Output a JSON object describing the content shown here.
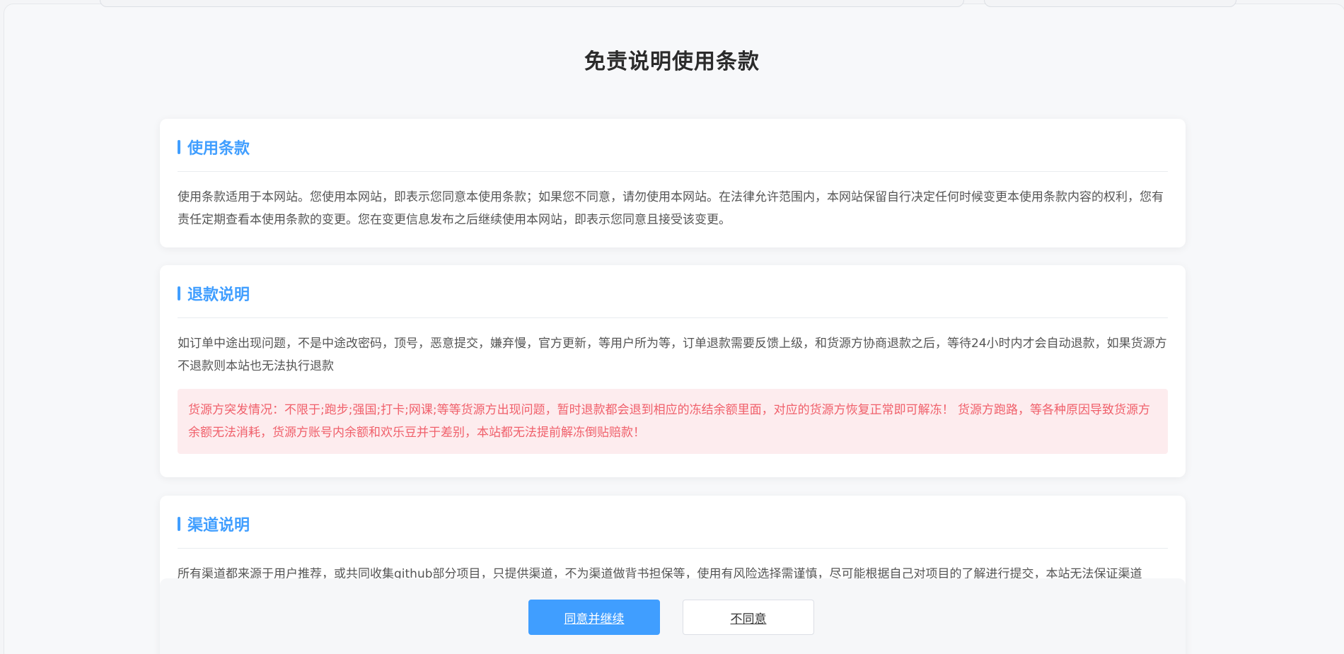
{
  "page": {
    "title": "免责说明使用条款"
  },
  "sections": {
    "terms": {
      "title": "使用条款",
      "body": "使用条款适用于本网站。您使用本网站，即表示您同意本使用条款；如果您不同意，请勿使用本网站。在法律允许范围内，本网站保留自行决定任何时候变更本使用条款内容的权利，您有责任定期查看本使用条款的变更。您在变更信息发布之后继续使用本网站，即表示您同意且接受该变更。"
    },
    "refund": {
      "title": "退款说明",
      "body": "如订单中途出现问题，不是中途改密码，顶号，恶意提交，嫌弃慢，官方更新，等用户所为等，订单退款需要反馈上级，和货源方协商退款之后，等待24小时内才会自动退款，如果货源方不退款则本站也无法执行退款",
      "notice": "货源方突发情况：不限于;跑步;强国;打卡;网课;等等货源方出现问题，暂时退款都会退到相应的冻结余额里面，对应的货源方恢复正常即可解冻！ 货源方跑路，等各种原因导致货源方余额无法消耗，货源方账号内余额和欢乐豆并于差别，本站都无法提前解冻倒贴赔款！"
    },
    "channel": {
      "title": "渠道说明",
      "body": "所有渠道都来源于用户推荐，或共同收集github部分项目，只提供渠道，不为渠道做背书担保等，使用有风险选择需谨慎，尽可能根据自己对项目的了解进行提交，本站无法保证渠道"
    }
  },
  "actions": {
    "agree_label": "同意并继续",
    "decline_label": "不同意"
  },
  "colors": {
    "accent": "#409eff",
    "notice_text": "#f0606b",
    "notice_bg": "#fdecee"
  }
}
